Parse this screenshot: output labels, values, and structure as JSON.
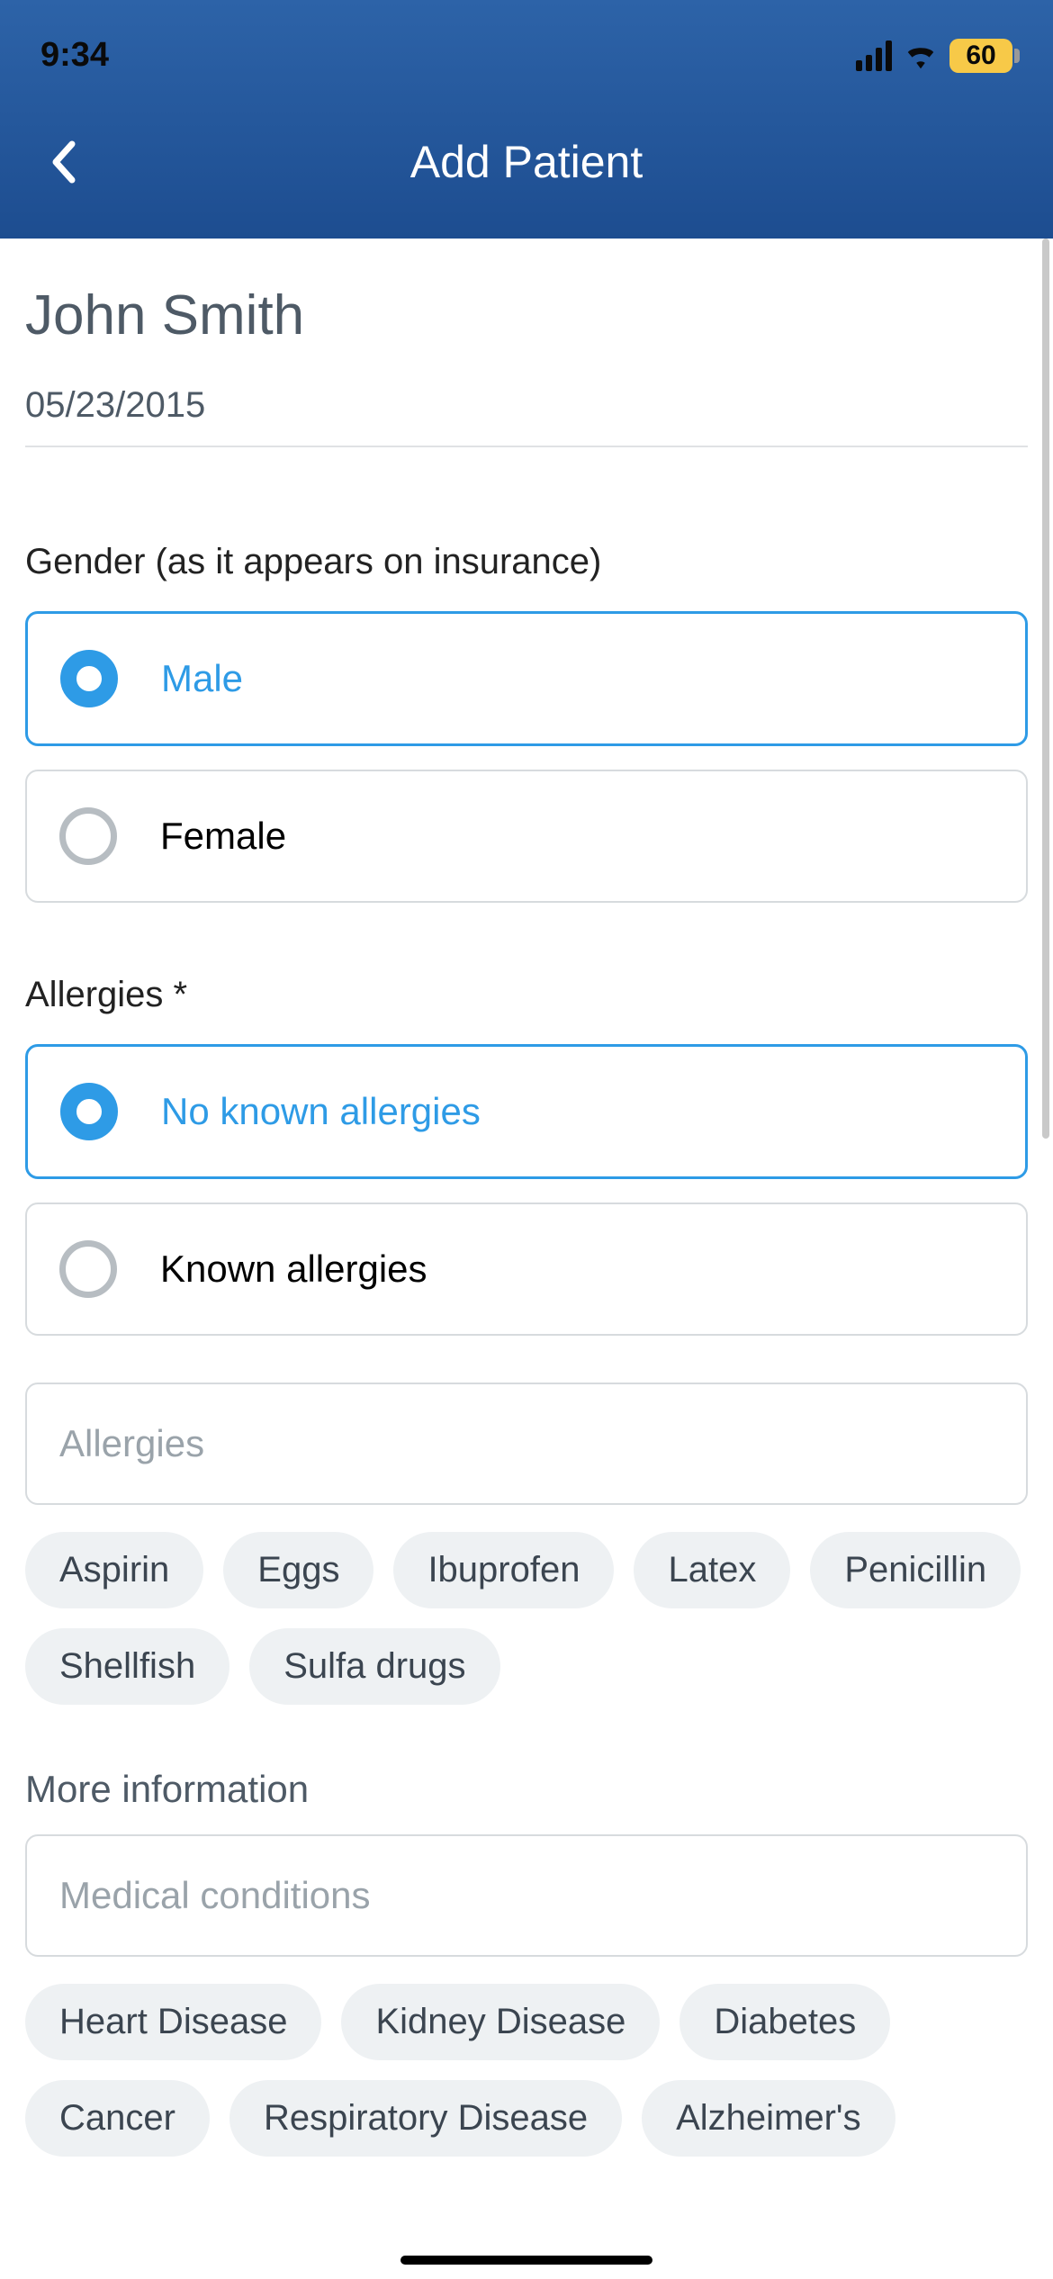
{
  "status": {
    "time": "9:34",
    "battery": "60"
  },
  "header": {
    "title": "Add Patient"
  },
  "patient": {
    "name": "John Smith",
    "dob": "05/23/2015"
  },
  "gender": {
    "label": "Gender (as it appears on insurance)",
    "options": [
      {
        "label": "Male",
        "selected": true
      },
      {
        "label": "Female",
        "selected": false
      }
    ]
  },
  "allergies": {
    "label": "Allergies *",
    "options": [
      {
        "label": "No known allergies",
        "selected": true
      },
      {
        "label": "Known allergies",
        "selected": false
      }
    ],
    "input_placeholder": "Allergies",
    "chips": [
      "Aspirin",
      "Eggs",
      "Ibuprofen",
      "Latex",
      "Penicillin",
      "Shellfish",
      "Sulfa drugs"
    ]
  },
  "more_info": {
    "label": "More information",
    "input_placeholder": "Medical conditions",
    "chips": [
      "Heart Disease",
      "Kidney Disease",
      "Diabetes",
      "Cancer",
      "Respiratory Disease",
      "Alzheimer's"
    ]
  }
}
